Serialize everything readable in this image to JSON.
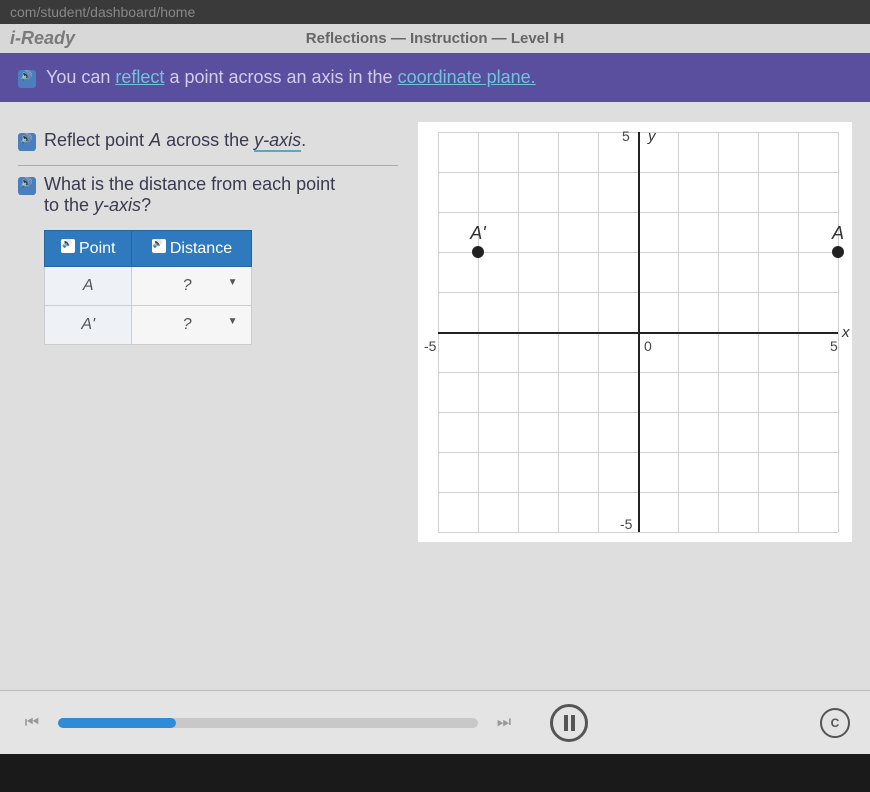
{
  "browser": {
    "url": "com/student/dashboard/home"
  },
  "header": {
    "app_name": "i-Ready",
    "lesson_title": "Reflections — Instruction — Level H"
  },
  "banner": {
    "prefix": "You can ",
    "reflect": "reflect",
    "mid": " a point across an axis in the ",
    "plane": "coordinate plane.",
    "suffix": ""
  },
  "steps": {
    "s1_prefix": "Reflect point ",
    "s1_point": "A",
    "s1_mid": " across the ",
    "s1_axis": "y-axis",
    "s1_end": ".",
    "s2_line1": "What is the distance from each point",
    "s2_line2_prefix": "to the ",
    "s2_axis": "y-axis",
    "s2_end": "?"
  },
  "table": {
    "head_point": "Point",
    "head_distance": "Distance",
    "rows": [
      {
        "point": "A",
        "distance": "?"
      },
      {
        "point": "A'",
        "distance": "?"
      }
    ]
  },
  "graph": {
    "xlabel": "x",
    "ylabel": "y",
    "ticks": {
      "neg5": "-5",
      "zero": "0",
      "pos5": "5",
      "top5": "5",
      "bot5": "-5"
    },
    "points": {
      "A": {
        "label": "A",
        "x": 5,
        "y": 2
      },
      "Ap": {
        "label": "A'",
        "x": -4,
        "y": 2
      }
    }
  },
  "footer": {
    "progress_pct": 28,
    "cc": "C"
  }
}
